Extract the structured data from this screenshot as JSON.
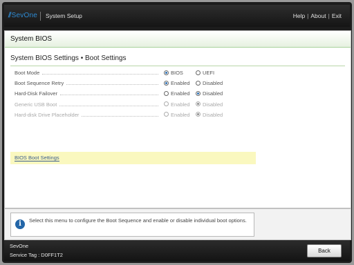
{
  "header": {
    "logo_text": "SevOne",
    "app_title": "System Setup",
    "links": [
      "Help",
      "About",
      "Exit"
    ]
  },
  "section": {
    "title": "System BIOS"
  },
  "content": {
    "title": "System BIOS Settings • Boot Settings",
    "settings": [
      {
        "label": "Boot Mode",
        "options": [
          "BIOS",
          "UEFI"
        ],
        "selected": 0,
        "disabled": false
      },
      {
        "label": "Boot Sequence Retry",
        "options": [
          "Enabled",
          "Disabled"
        ],
        "selected": 0,
        "disabled": false
      },
      {
        "label": "Hard-Disk Failover",
        "options": [
          "Enabled",
          "Disabled"
        ],
        "selected": 1,
        "disabled": false
      },
      {
        "label": "Generic USB Boot",
        "options": [
          "Enabled",
          "Disabled"
        ],
        "selected": 1,
        "disabled": true
      },
      {
        "label": "Hard-disk Drive Placeholder",
        "options": [
          "Enabled",
          "Disabled"
        ],
        "selected": 1,
        "disabled": true
      }
    ],
    "link_label": "BIOS Boot Settings"
  },
  "help": {
    "text": "Select this menu to configure the Boot Sequence and enable or disable individual boot options.",
    "icon": "info-icon"
  },
  "footer": {
    "line1": "SevOne",
    "line2": "Service Tag : D0FF1T2",
    "back_label": "Back"
  },
  "colors": {
    "accent": "#2e8bd4",
    "highlight": "#faf8bf",
    "radio_selected": "#2c6fb3"
  }
}
